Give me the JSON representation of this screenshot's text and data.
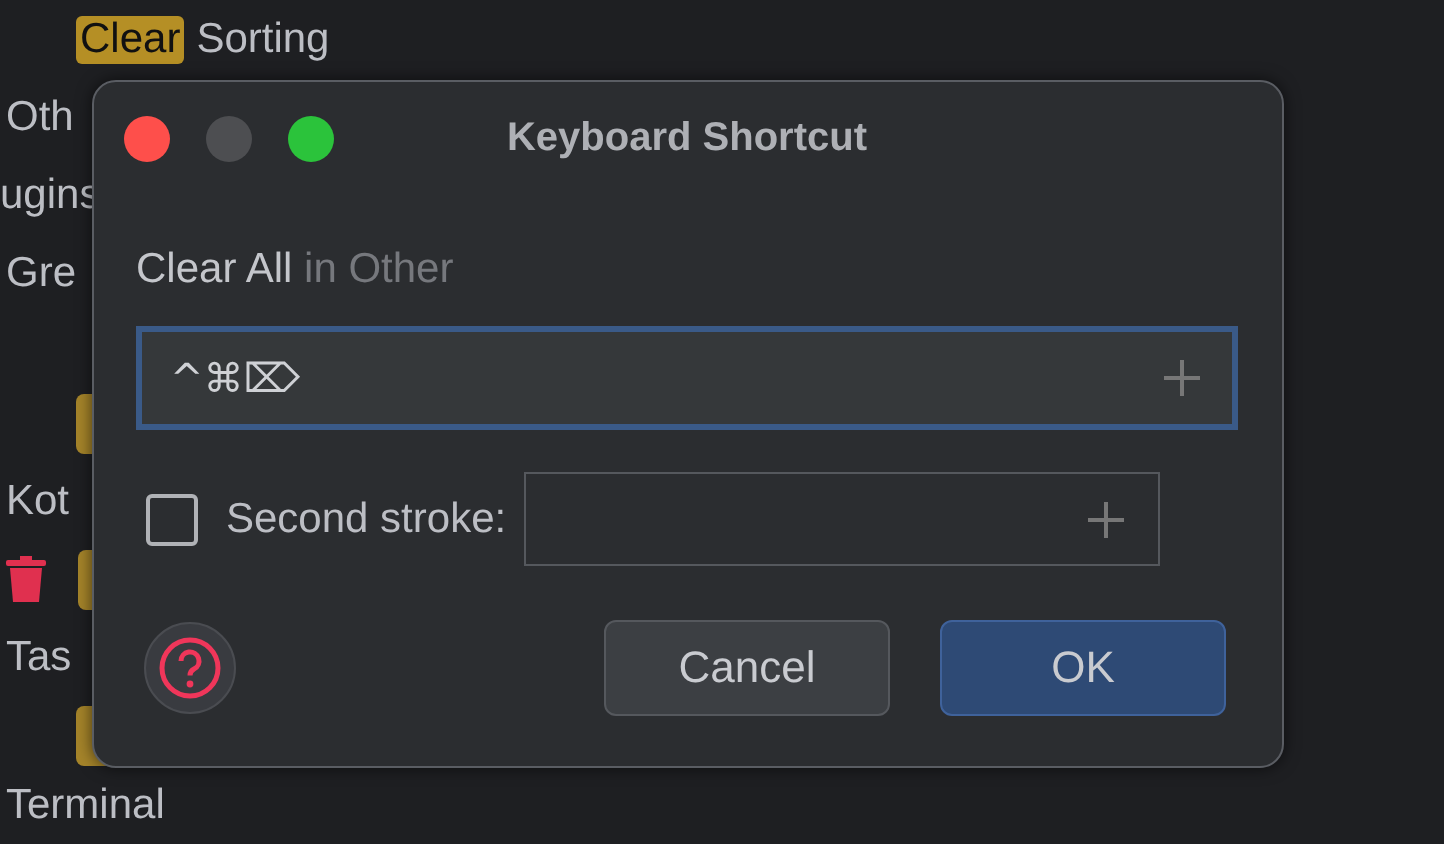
{
  "background_tree": [
    {
      "kind": "action",
      "match": "Clear",
      "text": "Sorting"
    },
    {
      "kind": "group",
      "text": "Oth"
    },
    {
      "kind": "group",
      "text": "ugins"
    },
    {
      "kind": "group",
      "text": "Gre"
    },
    {
      "kind": "badge"
    },
    {
      "kind": "group",
      "text": "Kot"
    },
    {
      "kind": "trash-badge"
    },
    {
      "kind": "group",
      "text": "Tas"
    },
    {
      "kind": "badge"
    },
    {
      "kind": "group",
      "text": "Terminal"
    }
  ],
  "dialog": {
    "title": "Keyboard Shortcut",
    "action": "Clear All",
    "context": "in Other",
    "first_stroke": {
      "value": "^⌘⌦"
    },
    "second_stroke": {
      "checked": false,
      "label": "Second stroke:"
    },
    "buttons": [
      {
        "label": "Cancel",
        "kind": "secondary"
      },
      {
        "label": "OK",
        "kind": "primary"
      }
    ]
  }
}
